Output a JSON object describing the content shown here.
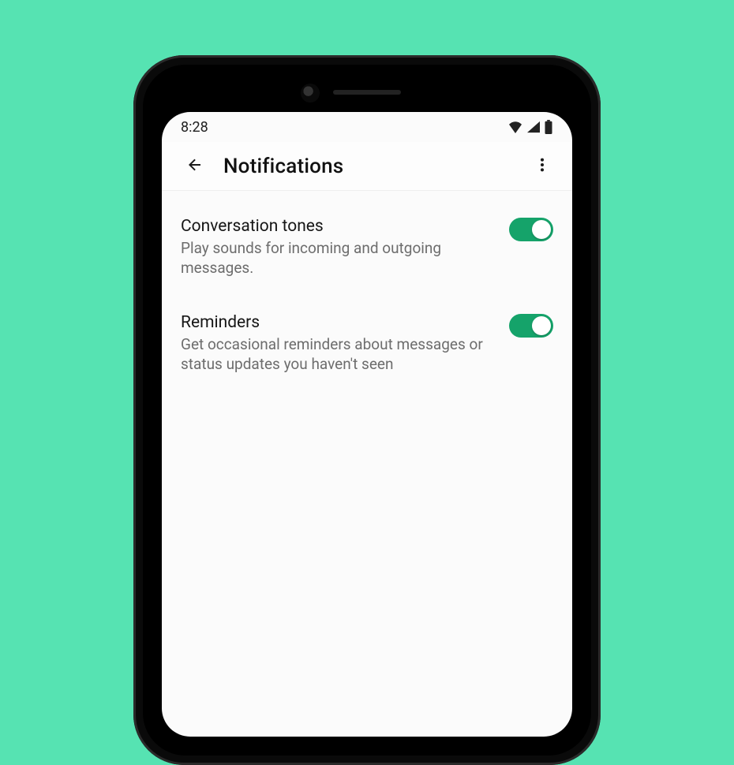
{
  "colors": {
    "accent": "#15a36a"
  },
  "statusbar": {
    "time": "8:28"
  },
  "appbar": {
    "title": "Notifications"
  },
  "settings": [
    {
      "key": "conversation-tones",
      "title": "Conversation tones",
      "subtitle": "Play sounds for incoming and outgoing messages.",
      "enabled": true
    },
    {
      "key": "reminders",
      "title": "Reminders",
      "subtitle": "Get occasional reminders about messages or status updates you haven't seen",
      "enabled": true
    }
  ]
}
